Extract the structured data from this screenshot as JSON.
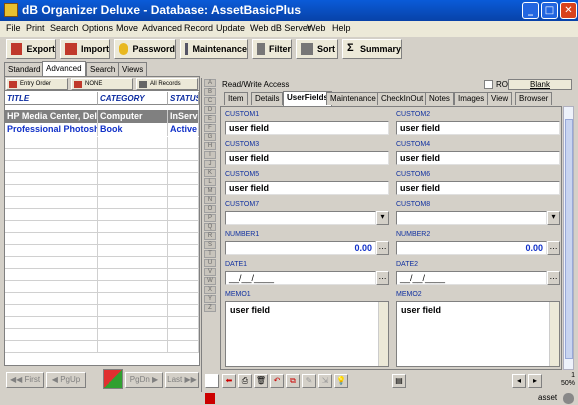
{
  "window": {
    "title": "dB Organizer Deluxe - Database: AssetBasicPlus"
  },
  "menu": [
    "File",
    "Print",
    "Search",
    "Options",
    "Move",
    "Advanced",
    "Record",
    "Update",
    "Web dB Server",
    "Web",
    "Help"
  ],
  "toolbar": {
    "export": "Export",
    "import": "Import",
    "password": "Password",
    "maintenance": "Maintenance",
    "filter": "Filter",
    "sort": "Sort",
    "summary": "Summary"
  },
  "left_tabs": [
    "Standard",
    "Advanced",
    "Search",
    "Views"
  ],
  "sort_buttons": {
    "entry_order": "Entry Order",
    "none": "NONE",
    "all_records": "All Records"
  },
  "grid": {
    "headers": [
      "TITLE",
      "CATEGORY",
      "STATUS"
    ],
    "rows": [
      {
        "title": "HP Media Center, Dell",
        "category": "Computer",
        "status": "InService"
      },
      {
        "title": "Professional Photoshop",
        "category": "Book",
        "status": "Active"
      }
    ]
  },
  "nav": {
    "first": "First",
    "pgup": "PgUp",
    "pgdn": "PgDn",
    "last": "Last"
  },
  "alphabet": [
    "A",
    "B",
    "C",
    "D",
    "E",
    "F",
    "G",
    "H",
    "I",
    "J",
    "K",
    "L",
    "M",
    "N",
    "O",
    "P",
    "Q",
    "R",
    "S",
    "T",
    "U",
    "V",
    "W",
    "X",
    "Y",
    "Z"
  ],
  "detail": {
    "access": "Read/Write Access",
    "ro": "RO",
    "blank": "Blank",
    "tabs": [
      "Item",
      "Details",
      "UserFields",
      "Maintenance",
      "CheckInOut",
      "Notes",
      "Images",
      "View",
      "Browser"
    ],
    "fields": {
      "custom1": {
        "label": "CUSTOM1",
        "value": "user field"
      },
      "custom2": {
        "label": "CUSTOM2",
        "value": "user field"
      },
      "custom3": {
        "label": "CUSTOM3",
        "value": "user field"
      },
      "custom4": {
        "label": "CUSTOM4",
        "value": "user field"
      },
      "custom5": {
        "label": "CUSTOM5",
        "value": "user field"
      },
      "custom6": {
        "label": "CUSTOM6",
        "value": "user field"
      },
      "custom7": {
        "label": "CUSTOM7",
        "value": ""
      },
      "custom8": {
        "label": "CUSTOM8",
        "value": ""
      },
      "number1": {
        "label": "NUMBER1",
        "value": "0.00"
      },
      "number2": {
        "label": "NUMBER2",
        "value": "0.00"
      },
      "date1": {
        "label": "DATE1",
        "value": "__/__/____"
      },
      "date2": {
        "label": "DATE2",
        "value": "__/__/____"
      },
      "memo1": {
        "label": "MEMO1",
        "value": "user field"
      },
      "memo2": {
        "label": "MEMO2",
        "value": "user field"
      }
    }
  },
  "status": {
    "record": "1",
    "zoom": "50%",
    "user": "asset"
  },
  "colors": {
    "titlebar": "#0a5bd8",
    "label_blue": "#1030a0",
    "row_selected": "#808080",
    "row_alt_text": "#1030c8"
  }
}
